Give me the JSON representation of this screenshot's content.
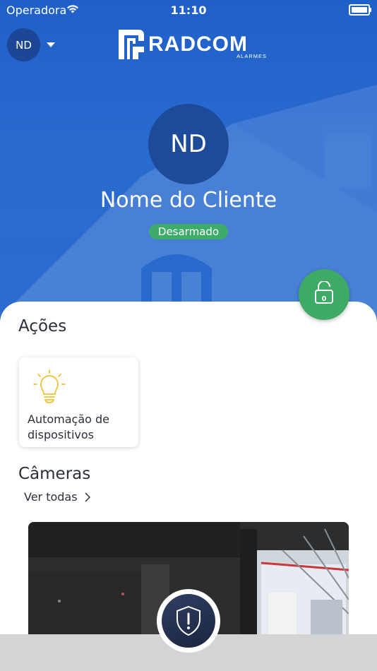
{
  "status_bar": {
    "carrier": "Operadora",
    "time": "11:10"
  },
  "header": {
    "user_initials": "ND",
    "logo_text": "RADCOM",
    "logo_subtext": "ALARMES"
  },
  "profile": {
    "initials": "ND",
    "name": "Nome do Cliente",
    "status": "Desarmado",
    "status_color": "#3dac6a"
  },
  "lock_button": {
    "count": "0",
    "color": "#3daa66"
  },
  "actions": {
    "title": "Ações",
    "items": [
      {
        "label": "Automação de dispositivos",
        "icon": "lightbulb-icon"
      }
    ]
  },
  "cameras": {
    "title": "Câmeras",
    "see_all": "Ver todas"
  },
  "colors": {
    "primary": "#2a6bd0",
    "accent": "#3dac6a",
    "dark": "#1b2540"
  }
}
